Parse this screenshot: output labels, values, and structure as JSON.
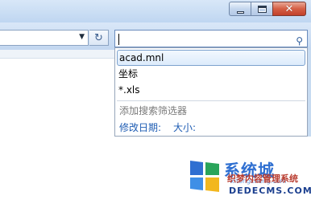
{
  "search": {
    "value": ""
  },
  "suggestions": [
    {
      "label": "acad.mnl"
    },
    {
      "label": "坐标"
    },
    {
      "label": "*.xls"
    }
  ],
  "filters": {
    "header": "添加搜索筛选器",
    "links": [
      {
        "label": "修改日期:"
      },
      {
        "label": "大小:"
      }
    ]
  },
  "watermark": {
    "brand": "系统城",
    "small": "xitongcheng.com",
    "site_name": "织梦内容管理系统",
    "url": "DEDECMS.COM"
  },
  "colors": {
    "accent": "#1e5cb3",
    "logo_blue": "#2f6fd1",
    "logo_green": "#2aa45a",
    "logo_yellow": "#f2b71f",
    "close_red": "#c2402a"
  },
  "icons": {
    "minimize": "minimize-icon",
    "maximize": "maximize-icon",
    "close": "close-icon",
    "refresh": "refresh-icon",
    "search": "search-icon",
    "dropdown": "chevron-down-icon"
  }
}
